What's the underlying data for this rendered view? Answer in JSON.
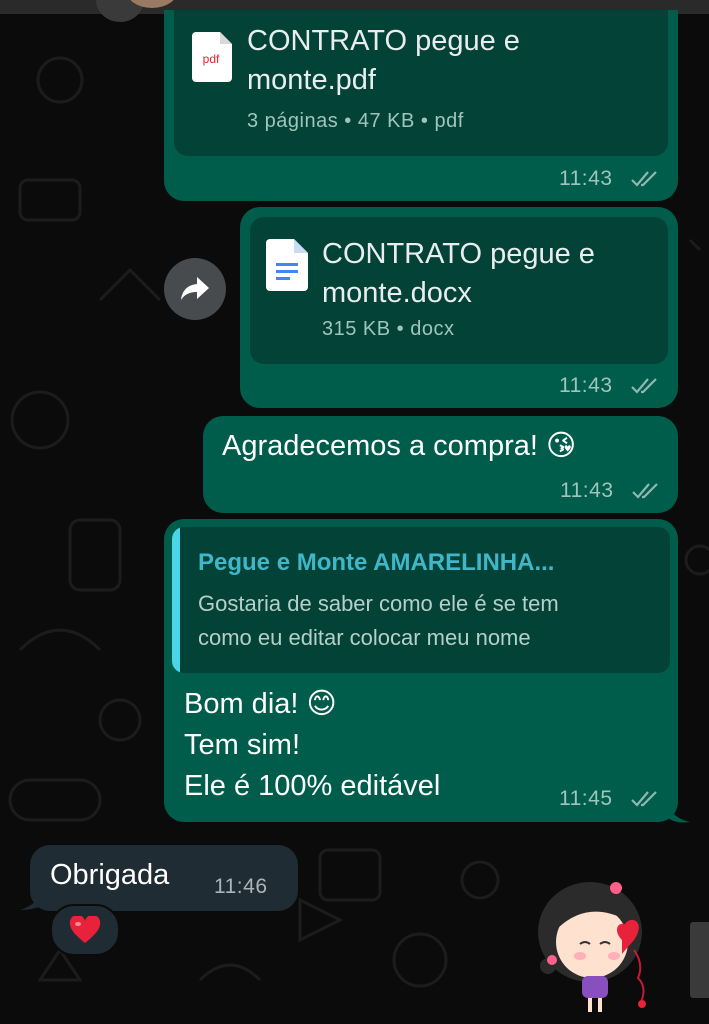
{
  "messages": [
    {
      "type": "document",
      "direction": "out",
      "icon": "pdf-file-icon",
      "icon_label": "pdf",
      "title_line1": "CONTRATO pegue e",
      "title_line2": "monte.pdf",
      "meta": "3 páginas • 47 KB • pdf",
      "time": "11:43",
      "status": "read"
    },
    {
      "type": "document",
      "direction": "out",
      "icon": "docs-file-icon",
      "title_line1": "CONTRATO pegue e",
      "title_line2": "monte.docx",
      "meta": "315 KB • docx",
      "time": "11:43",
      "status": "read"
    },
    {
      "type": "text",
      "direction": "out",
      "text": "Agradecemos a compra! 😘",
      "time": "11:43",
      "status": "read"
    },
    {
      "type": "reply",
      "direction": "out",
      "quote_author": "Pegue e Monte AMARELINHA...",
      "quote_line1": "Gostaria de saber como ele é se tem",
      "quote_line2": "como eu editar colocar meu nome",
      "line1": "Bom dia! 😊",
      "line2": "Tem sim!",
      "line3": "Ele é 100% editável",
      "time": "11:45",
      "status": "read"
    },
    {
      "type": "text",
      "direction": "in",
      "text": "Obrigada",
      "time": "11:46",
      "reaction": "❤️"
    }
  ],
  "forward_icon": "forward-arrow-icon",
  "colors": {
    "outgoing_bubble": "#005c4b",
    "incoming_bubble": "#202c33",
    "quote_accent": "#4ad5e8",
    "background": "#0b0b0b"
  }
}
